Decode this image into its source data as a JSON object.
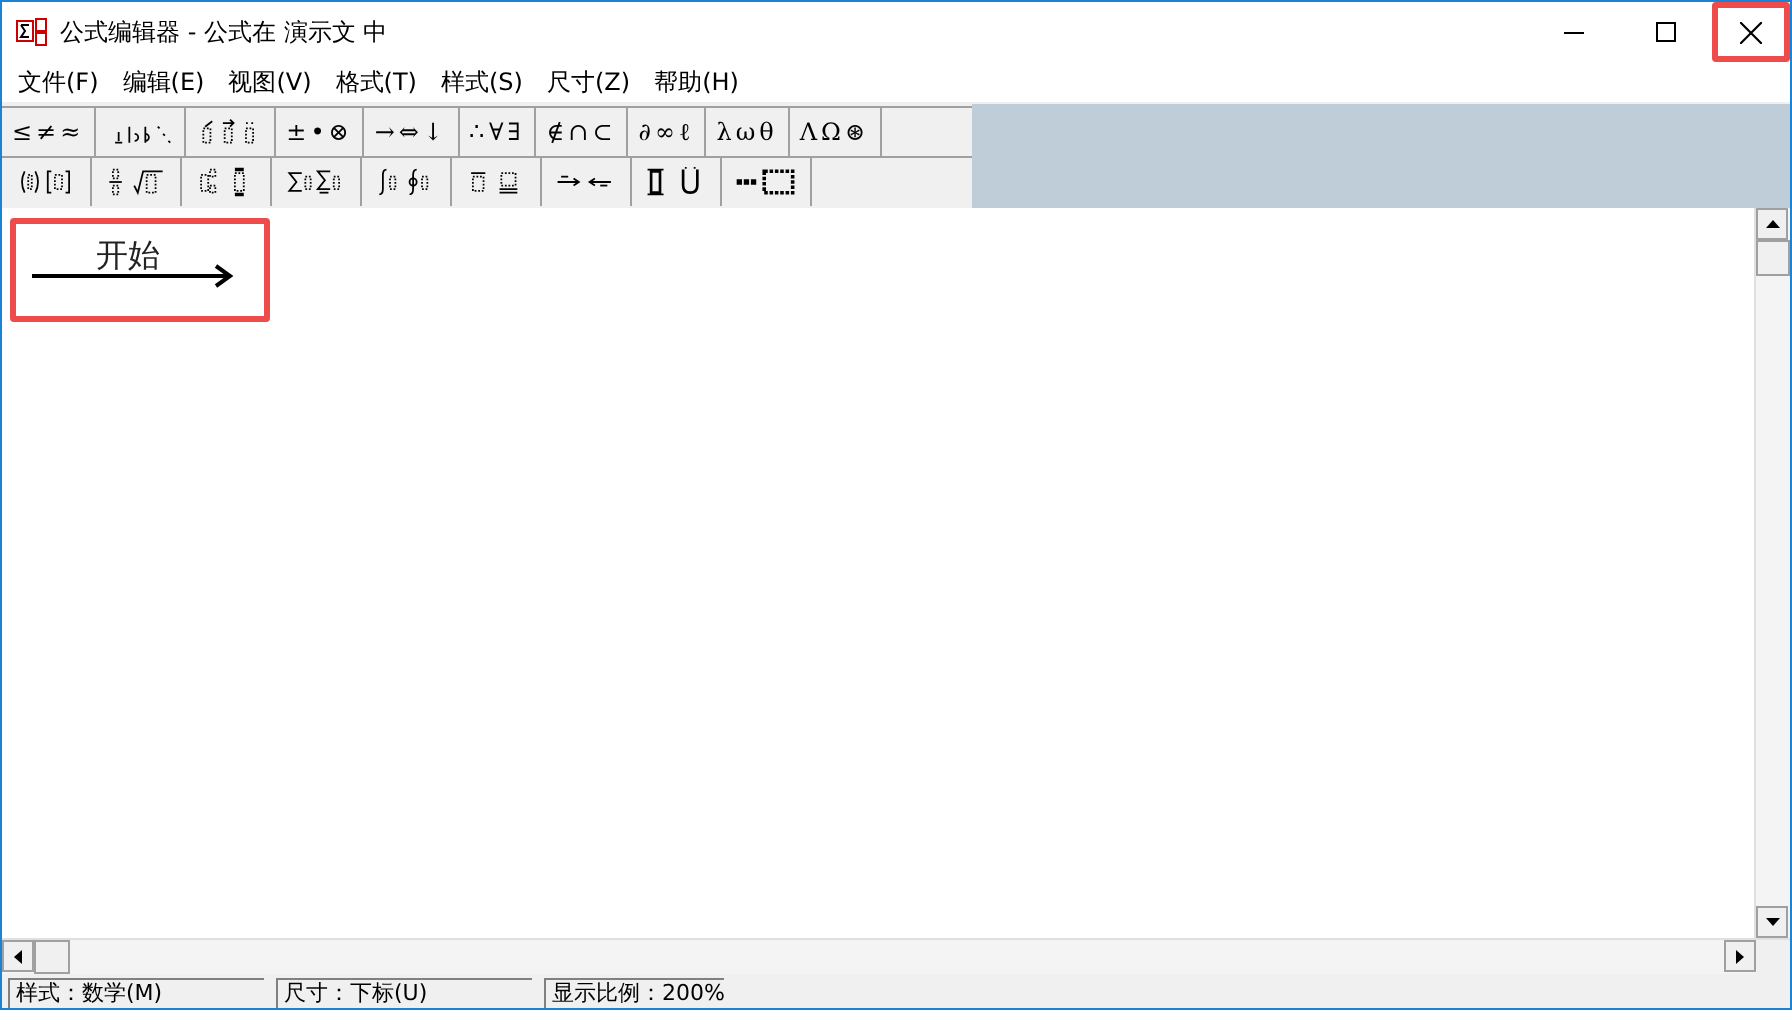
{
  "window": {
    "title": "公式编辑器 - 公式在 演示文 中"
  },
  "menu": [
    "文件(F)",
    "编辑(E)",
    "视图(V)",
    "格式(T)",
    "样式(S)",
    "尺寸(Z)",
    "帮助(H)"
  ],
  "palette_rows": [
    [
      {
        "kind": "symbols",
        "label": "≤≠≈"
      },
      {
        "kind": "spaces"
      },
      {
        "kind": "embellishments"
      },
      {
        "kind": "symbols",
        "label": "±•⊗"
      },
      {
        "kind": "symbols",
        "label": "→⇔↓"
      },
      {
        "kind": "symbols",
        "label": "∴∀∃"
      },
      {
        "kind": "symbols",
        "label": "∉∩⊂"
      },
      {
        "kind": "symbols",
        "label": "∂∞ℓ"
      },
      {
        "kind": "symbols",
        "label": "λωθ"
      },
      {
        "kind": "symbols",
        "label": "ΛΩ⊛"
      }
    ],
    [
      {
        "kind": "fences"
      },
      {
        "kind": "fractions"
      },
      {
        "kind": "scripts"
      },
      {
        "kind": "sums"
      },
      {
        "kind": "integrals"
      },
      {
        "kind": "bars"
      },
      {
        "kind": "labeled-arrows"
      },
      {
        "kind": "products"
      },
      {
        "kind": "matrices"
      }
    ]
  ],
  "editor": {
    "label_text": "开始"
  },
  "highlights": {
    "formula": true,
    "close_button": true
  },
  "status_bar": [
    "样式：数学(M)",
    "尺寸：下标(U)",
    "显示比例：200%"
  ]
}
